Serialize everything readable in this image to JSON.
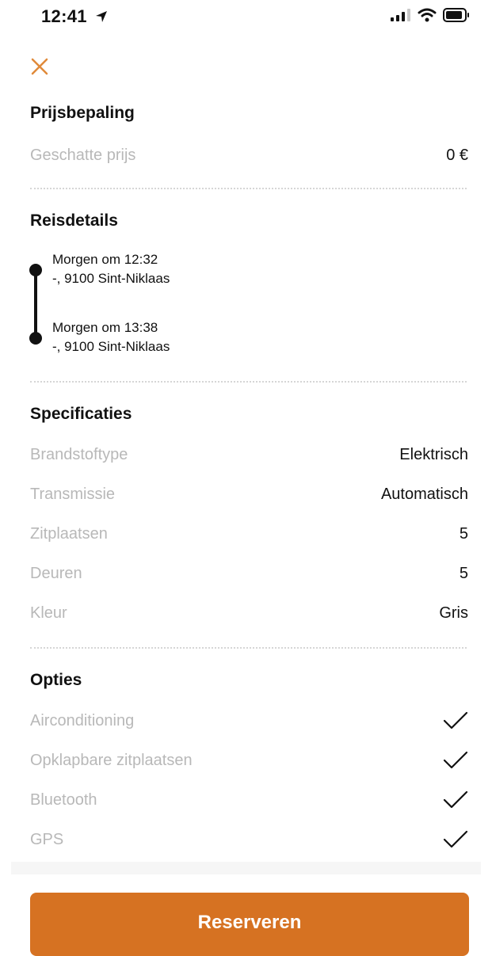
{
  "status_bar": {
    "time": "12:41"
  },
  "close": {
    "icon": "close-icon",
    "color": "#e08a3a"
  },
  "pricing": {
    "title": "Prijsbepaling",
    "estimated_label": "Geschatte prijs",
    "estimated_value": "0 €"
  },
  "trip": {
    "title": "Reisdetails",
    "stops": [
      {
        "time": "Morgen om 12:32",
        "address": "-, 9100 Sint-Niklaas"
      },
      {
        "time": "Morgen om 13:38",
        "address": "-, 9100 Sint-Niklaas"
      }
    ]
  },
  "specs": {
    "title": "Specificaties",
    "items": [
      {
        "label": "Brandstoftype",
        "value": "Elektrisch"
      },
      {
        "label": "Transmissie",
        "value": "Automatisch"
      },
      {
        "label": "Zitplaatsen",
        "value": "5"
      },
      {
        "label": "Deuren",
        "value": "5"
      },
      {
        "label": "Kleur",
        "value": "Gris"
      }
    ]
  },
  "options": {
    "title": "Opties",
    "items": [
      {
        "label": "Airconditioning",
        "icon": "checkmark-icon"
      },
      {
        "label": "Opklapbare zitplaatsen",
        "icon": "checkmark-icon"
      },
      {
        "label": "Bluetooth",
        "icon": "checkmark-icon"
      },
      {
        "label": "GPS",
        "icon": "checkmark-icon"
      }
    ]
  },
  "cta": {
    "label": "Reserveren",
    "color": "#d67222"
  }
}
